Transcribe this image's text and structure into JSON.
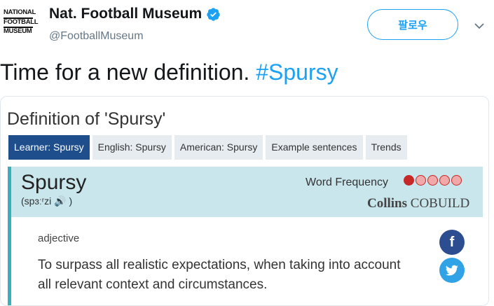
{
  "header": {
    "logo_lines": [
      "NATIONAL",
      "FOOTBALL",
      "MUSEUM"
    ],
    "display_name": "Nat. Football Museum",
    "handle": "@FootballMuseum",
    "follow_label": "팔로우"
  },
  "tweet": {
    "text": "Time for a new definition. ",
    "hashtag": "#Spursy"
  },
  "card": {
    "title": "Definition of 'Spursy'",
    "tabs": [
      {
        "label": "Learner: Spursy",
        "active": true
      },
      {
        "label": "English: Spursy",
        "active": false
      },
      {
        "label": "American: Spursy",
        "active": false
      },
      {
        "label": "Example sentences",
        "active": false
      },
      {
        "label": "Trends",
        "active": false
      }
    ],
    "headword": "Spursy",
    "pronunciation": "(spɜːʳzi",
    "pronunciation_close": ")",
    "frequency_label": "Word Frequency",
    "frequency_level": 1,
    "frequency_max": 5,
    "brand_bold": "Collins",
    "brand_rest": "COBUILD",
    "part_of_speech": "adjective",
    "definition": "To surpass all realistic expectations, when taking into account all relevant context and circumstances."
  },
  "colors": {
    "accent": "#1da1f2",
    "active_tab": "#1f4e8c",
    "entry_bg": "#c9e6ec",
    "facebook": "#2c4d8f",
    "twitter": "#2fa3e6"
  }
}
